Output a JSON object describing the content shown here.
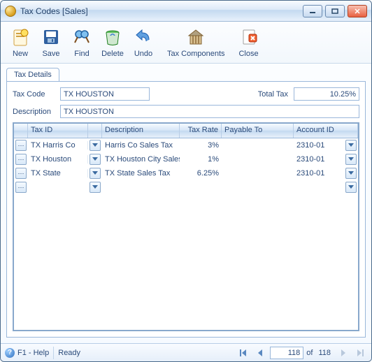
{
  "window": {
    "title": "Tax Codes [Sales]"
  },
  "toolbar": {
    "new": "New",
    "save": "Save",
    "find": "Find",
    "delete": "Delete",
    "undo": "Undo",
    "tax_components": "Tax Components",
    "close": "Close"
  },
  "tab": {
    "details": "Tax Details"
  },
  "form": {
    "tax_code_label": "Tax Code",
    "tax_code_value": "TX HOUSTON",
    "total_tax_label": "Total Tax",
    "total_tax_value": "10.25%",
    "description_label": "Description",
    "description_value": "TX HOUSTON"
  },
  "grid": {
    "headers": {
      "tax_id": "Tax ID",
      "description": "Description",
      "tax_rate": "Tax Rate",
      "payable_to": "Payable To",
      "account_id": "Account ID"
    },
    "rows": [
      {
        "tax_id": "TX Harris Co",
        "description": "Harris Co Sales Tax",
        "tax_rate": "3%",
        "payable_to": "",
        "account_id": "2310-01"
      },
      {
        "tax_id": "TX Houston",
        "description": "TX Houston City Sales",
        "tax_rate": "1%",
        "payable_to": "",
        "account_id": "2310-01"
      },
      {
        "tax_id": "TX State",
        "description": "TX State Sales Tax",
        "tax_rate": "6.25%",
        "payable_to": "",
        "account_id": "2310-01"
      },
      {
        "tax_id": "",
        "description": "",
        "tax_rate": "",
        "payable_to": "",
        "account_id": ""
      }
    ]
  },
  "status": {
    "help": "F1 - Help",
    "ready": "Ready",
    "current": "118",
    "of": "of",
    "total": "118"
  }
}
